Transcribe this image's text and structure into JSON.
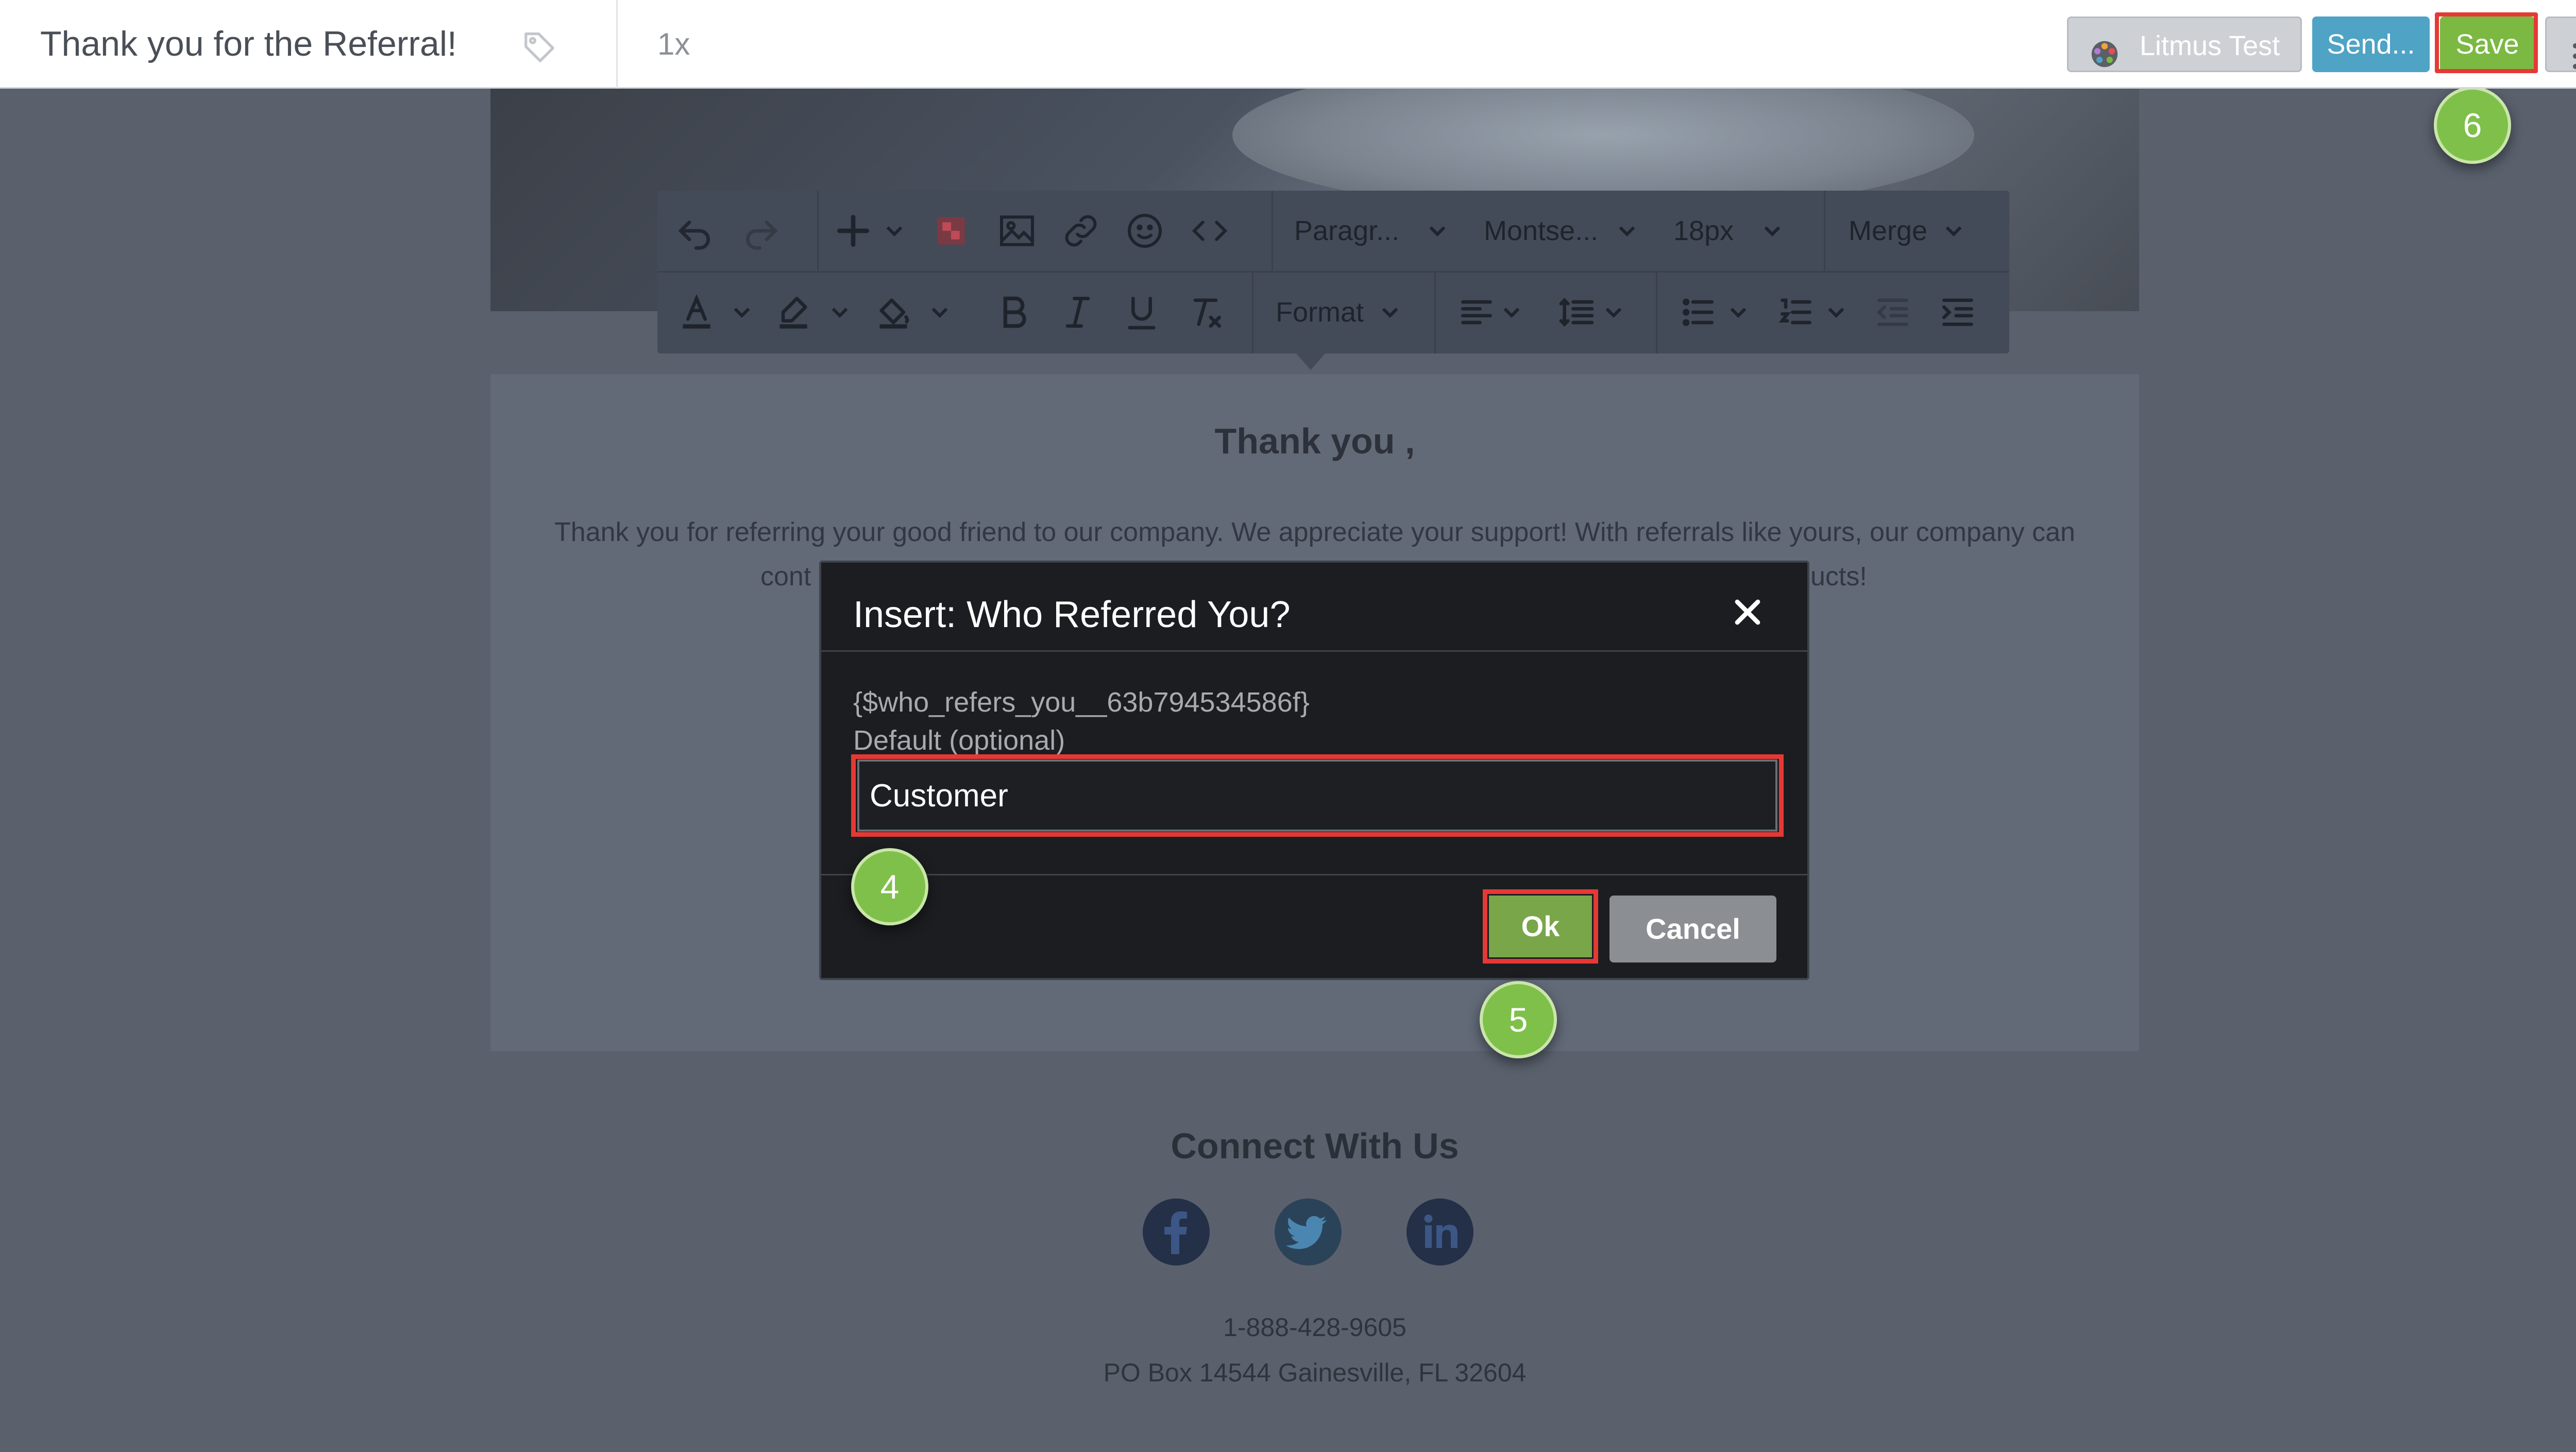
{
  "topbar": {
    "title": "Thank you for the Referral!",
    "tag_icon": "tag-icon",
    "zoom": "1x",
    "litmus_label": "Litmus Test",
    "send_label": "Send...",
    "save_label": "Save",
    "more_icon": "kebab-icon"
  },
  "editor_toolbar": {
    "paragraph": "Paragr...",
    "font": "Montse...",
    "size": "18px",
    "merge": "Merge",
    "format": "Format"
  },
  "email": {
    "heading": "Thank you ,",
    "paragraph_line1": "Thank you for referring your good friend to our company. We appreciate your support! With referrals like yours, our company can",
    "paragraph_line2_left": "cont",
    "paragraph_line2_right": "ucts!",
    "connect_heading": "Connect With Us",
    "phone": "1-888-428-9605",
    "address": "PO Box 14544 Gainesville, FL 32604",
    "social_icons": [
      "facebook-icon",
      "twitter-icon",
      "linkedin-icon"
    ]
  },
  "modal": {
    "title": "Insert: Who Referred You?",
    "merge_tag": "{$who_refers_you__63b794534586f}",
    "default_label": "Default (optional)",
    "default_value": "Customer",
    "ok_label": "Ok",
    "cancel_label": "Cancel"
  },
  "steps": {
    "step4": "4",
    "step5": "5",
    "step6": "6"
  },
  "colors": {
    "save_green": "#7bb943",
    "send_blue": "#4fa3c4",
    "highlight_red": "#e53935",
    "badge_green": "#7fc04a"
  }
}
